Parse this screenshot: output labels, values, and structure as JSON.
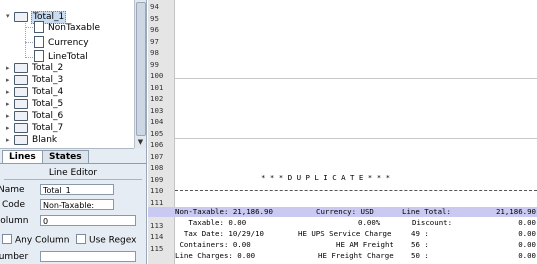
{
  "tree": {
    "items": [
      {
        "label": "Total_1",
        "kind": "folder",
        "selected": true
      },
      {
        "label": "NonTaxable",
        "kind": "doc"
      },
      {
        "label": "Currency",
        "kind": "doc"
      },
      {
        "label": "LineTotal",
        "kind": "doc"
      },
      {
        "label": "Total_2",
        "kind": "folder"
      },
      {
        "label": "Total_3",
        "kind": "folder"
      },
      {
        "label": "Total_4",
        "kind": "folder"
      },
      {
        "label": "Total_5",
        "kind": "folder"
      },
      {
        "label": "Total_6",
        "kind": "folder"
      },
      {
        "label": "Total_7",
        "kind": "folder"
      },
      {
        "label": "Blank",
        "kind": "folder"
      }
    ]
  },
  "tabs": [
    {
      "label": "Lines",
      "active": true
    },
    {
      "label": "States",
      "active": false
    }
  ],
  "editor": {
    "title": "Line Editor",
    "name_label": "Name",
    "name_value": "Total_1",
    "code_label": "Code",
    "code_value": "Non-Taxable:",
    "column_label": "Column",
    "column_value": "0",
    "any_column_label": "Any Column",
    "use_regex_label": "Use Regex",
    "number_label": "Number",
    "number_value": ""
  },
  "report": {
    "line_numbers": [
      "94",
      "95",
      "96",
      "97",
      "98",
      "99",
      "100",
      "101",
      "102",
      "103",
      "104",
      "105",
      "106",
      "107",
      "108",
      "109",
      "110",
      "111",
      "112",
      "113",
      "114",
      "115"
    ],
    "duplicate_banner": "* * * D U P L I C A T E * * *",
    "rows": [
      {
        "c1": "Non-Taxable: 21,186.90",
        "c2": "Currency: USD",
        "c3": "Line Total:",
        "c4": "21,186.90"
      },
      {
        "c1": "   Taxable: 0.00",
        "c2": "0.00%",
        "c3": "Discount:",
        "c4": "0.00"
      },
      {
        "c1": "  Tax Date: 10/29/10",
        "c2": "HE UPS Service Charge",
        "c3": "49 :",
        "c4": "0.00"
      },
      {
        "c1": " Containers: 0.00",
        "c2": "HE AM Freight",
        "c3": "56 :",
        "c4": "0.00"
      },
      {
        "c1": "Line Charges: 0.00",
        "c2": "HE Freight Charge",
        "c3": "50 :",
        "c4": "0.00"
      }
    ]
  },
  "colors": {
    "highlight_row": "#c9c9f2",
    "panel_bg": "#e6ecf3",
    "selected_tree_item": "#c9dcf2"
  }
}
